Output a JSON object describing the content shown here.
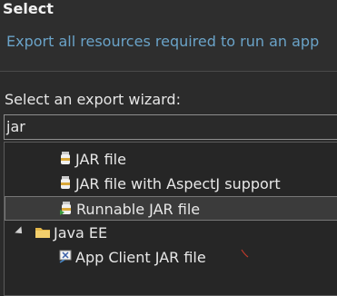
{
  "header": {
    "title": "Select",
    "subtitle": "Export all resources required to run an app"
  },
  "wizard": {
    "prompt": "Select an export wizard:",
    "filter_value": "jar"
  },
  "tree": {
    "items": [
      {
        "label": "JAR file",
        "icon": "jar-icon"
      },
      {
        "label": "JAR file with AspectJ support",
        "icon": "jar-icon"
      },
      {
        "label": "Runnable JAR file",
        "icon": "runnable-jar-icon",
        "selected": true
      },
      {
        "label": "Java EE",
        "icon": "folder-icon",
        "expanded": true
      },
      {
        "label": "App Client JAR file",
        "icon": "app-client-jar-icon"
      }
    ]
  },
  "colors": {
    "background": "#2b2b2b",
    "subtitle": "#6aa3c8",
    "folder": "#e5b84a"
  }
}
